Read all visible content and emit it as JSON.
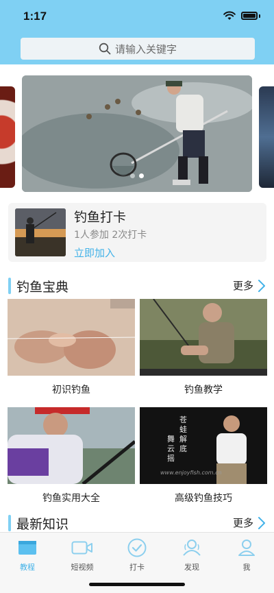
{
  "status_bar": {
    "time": "1:17"
  },
  "search": {
    "placeholder": "请输入关键字"
  },
  "banner": {
    "slide_count": 2,
    "active_index": 1
  },
  "checkin": {
    "title": "钓鱼打卡",
    "stats": "1人参加 2次打卡",
    "join_label": "立即加入"
  },
  "section_guide": {
    "title": "钓鱼宝典",
    "more_label": "更多",
    "items": [
      {
        "label": "初识钓鱼"
      },
      {
        "label": "钓鱼教学"
      },
      {
        "label": "钓鱼实用大全"
      },
      {
        "label": "高级钓鱼技巧"
      }
    ]
  },
  "thumb_texts": {
    "img2_caption": "",
    "img4_vertical": [
      "苍",
      "蛙",
      "解",
      "底",
      "舞",
      "云",
      "摇"
    ],
    "img4_url": "www.enjoyfish.com.cn"
  },
  "section_latest": {
    "title": "最新知识",
    "more_label": "更多"
  },
  "tabbar": {
    "items": [
      {
        "label": "教程",
        "icon": "book-icon",
        "active": true
      },
      {
        "label": "短视频",
        "icon": "video-icon",
        "active": false
      },
      {
        "label": "打卡",
        "icon": "check-circle-icon",
        "active": false
      },
      {
        "label": "发现",
        "icon": "people-icon",
        "active": false
      },
      {
        "label": "我",
        "icon": "person-icon",
        "active": false
      }
    ]
  },
  "colors": {
    "accent": "#42b2e8",
    "header": "#7fd0f3",
    "inactive_icon": "#8ccfee"
  }
}
